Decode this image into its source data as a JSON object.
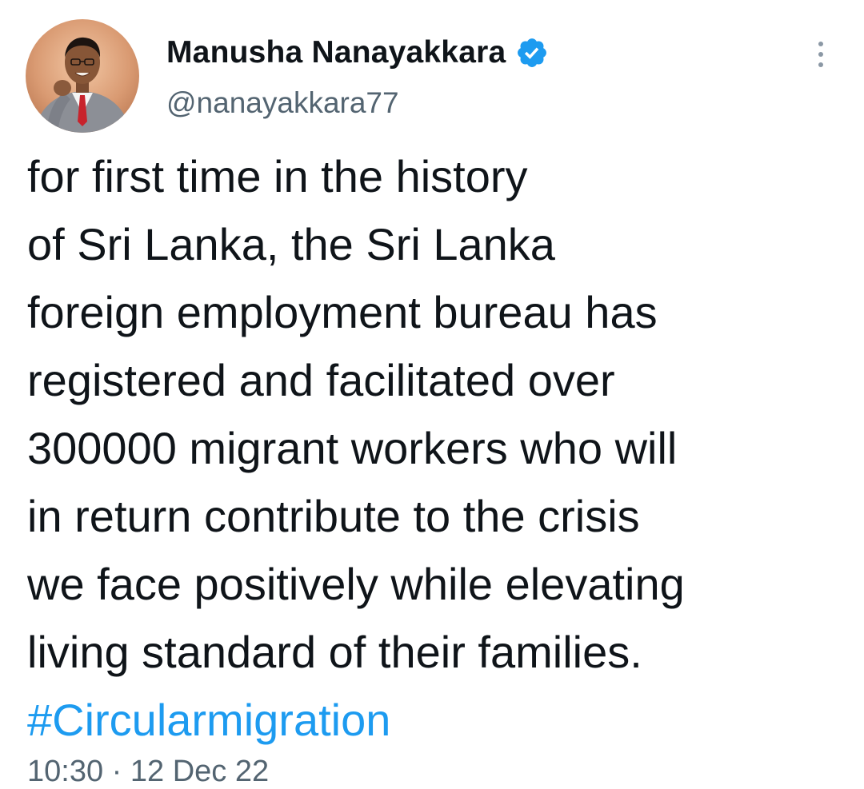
{
  "tweet": {
    "author": {
      "display_name": "Manusha Nanayakkara",
      "handle": "@nanayakkara77",
      "verified": true
    },
    "text_lines": [
      "for first time in the history",
      "of Sri Lanka, the Sri Lanka",
      "foreign employment bureau has",
      "registered and facilitated over",
      "300000 migrant workers who will",
      "in return contribute to the crisis",
      "we face positively while elevating",
      "living standard of their families."
    ],
    "hashtag": "#Circularmigration",
    "timestamp_partial": "10:30 · 12 Dec 22"
  },
  "icons": {
    "verified": "verified-badge-icon",
    "more": "more-options-icon"
  },
  "colors": {
    "text": "#0f1419",
    "secondary_text": "#536471",
    "link": "#1d9bf0",
    "verified_badge": "#1d9bf0",
    "background": "#ffffff"
  }
}
